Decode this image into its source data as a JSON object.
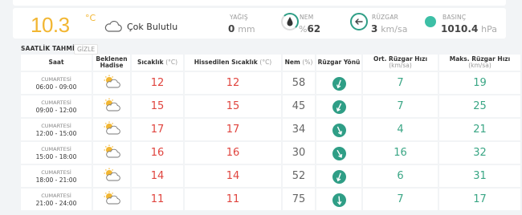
{
  "current": {
    "temperature": "10.3",
    "temp_unit": "°C",
    "condition": "Çok Bulutlu",
    "metrics": [
      {
        "label": "YAĞIŞ",
        "value": "0",
        "unit": "mm",
        "icon": "precipitation-icon"
      },
      {
        "label": "NEM",
        "value": "62",
        "prefix": "%",
        "icon": "humidity-icon"
      },
      {
        "label": "RÜZGAR",
        "value": "3",
        "unit": "km/sa",
        "icon": "wind-arrow-icon"
      },
      {
        "label": "BASINÇ",
        "value": "1010.4",
        "unit": "hPa",
        "icon": "pressure-dot-icon"
      }
    ]
  },
  "hourly": {
    "title": "SAATLİK TAHMİN",
    "hide_label": "GİZLE",
    "headers": {
      "time": "Saat",
      "event": "Beklenen Hadise",
      "temp": "Sıcaklık",
      "temp_unit": "(°C)",
      "feels": "Hissedilen Sıcaklık",
      "feels_unit": "(°C)",
      "humidity": "Nem",
      "humidity_unit": "(%)",
      "wind_dir": "Rüzgar Yönü",
      "wind_avg": "Ort. Rüzgar Hızı",
      "wind_avg_unit": "(km/sa)",
      "wind_max": "Maks. Rüzgar Hızı",
      "wind_max_unit": "(km/sa)"
    },
    "rows": [
      {
        "day": "CUMARTESİ",
        "time": "06:00 - 09:00",
        "temp": "12",
        "feels": "12",
        "humidity": "58",
        "wind_deg": 200,
        "wind_avg": "7",
        "wind_max": "19"
      },
      {
        "day": "CUMARTESİ",
        "time": "09:00 - 12:00",
        "temp": "15",
        "feels": "15",
        "humidity": "45",
        "wind_deg": 205,
        "wind_avg": "7",
        "wind_max": "25"
      },
      {
        "day": "CUMARTESİ",
        "time": "12:00 - 15:00",
        "temp": "17",
        "feels": "17",
        "humidity": "34",
        "wind_deg": 155,
        "wind_avg": "4",
        "wind_max": "21"
      },
      {
        "day": "CUMARTESİ",
        "time": "15:00 - 18:00",
        "temp": "16",
        "feels": "16",
        "humidity": "30",
        "wind_deg": 150,
        "wind_avg": "16",
        "wind_max": "32"
      },
      {
        "day": "CUMARTESİ",
        "time": "18:00 - 21:00",
        "temp": "14",
        "feels": "14",
        "humidity": "52",
        "wind_deg": 200,
        "wind_avg": "6",
        "wind_max": "31"
      },
      {
        "day": "CUMARTESİ",
        "time": "21:00 - 24:00",
        "temp": "11",
        "feels": "11",
        "humidity": "75",
        "wind_deg": 175,
        "wind_avg": "7",
        "wind_max": "17"
      }
    ]
  },
  "colors": {
    "temp_accent": "#f2b632",
    "temp_red": "#e0443e",
    "wind_green": "#3aa685",
    "teal": "#2f9e86"
  }
}
